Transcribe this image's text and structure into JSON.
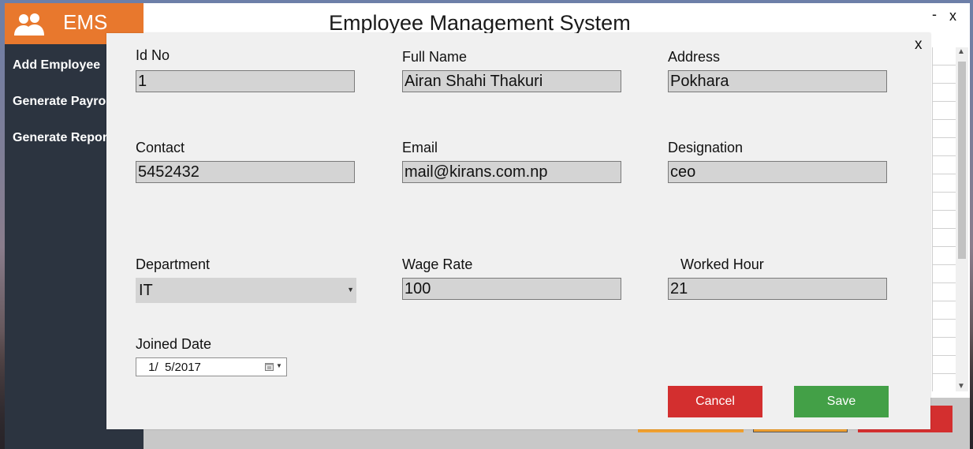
{
  "app": {
    "brand": "EMS",
    "title": "Employee Management System",
    "minimize": "-",
    "close": "x"
  },
  "sidebar": {
    "items": [
      {
        "label": "Add Employee"
      },
      {
        "label": "Generate Payroll"
      },
      {
        "label": "Generate Report"
      }
    ]
  },
  "dialog": {
    "close": "x",
    "fields": {
      "id_no": {
        "label": "Id No",
        "value": "1"
      },
      "full_name": {
        "label": "Full Name",
        "value": "Airan Shahi Thakuri"
      },
      "address": {
        "label": "Address",
        "value": "Pokhara"
      },
      "contact": {
        "label": "Contact",
        "value": "5452432"
      },
      "email": {
        "label": "Email",
        "value": "mail@kirans.com.np"
      },
      "designation": {
        "label": "Designation",
        "value": "ceo"
      },
      "department": {
        "label": "Department",
        "value": "IT"
      },
      "wage_rate": {
        "label": "Wage Rate",
        "value": "100"
      },
      "worked_hour": {
        "label": "Worked Hour",
        "value": "21"
      },
      "joined_date": {
        "label": "Joined Date",
        "value": " 1/  5/2017"
      }
    },
    "buttons": {
      "cancel": "Cancel",
      "save": "Save"
    }
  },
  "colors": {
    "brand": "#e8782d",
    "sidebar": "#2c3440",
    "cancel": "#d32f2f",
    "save": "#43a047",
    "bg_btn_orange": "#f0a030",
    "bg_btn_red": "#d32f2f"
  },
  "icons": {
    "brand": "users-icon",
    "calendar": "calendar-icon",
    "dropdown": "chevron-down-icon"
  }
}
